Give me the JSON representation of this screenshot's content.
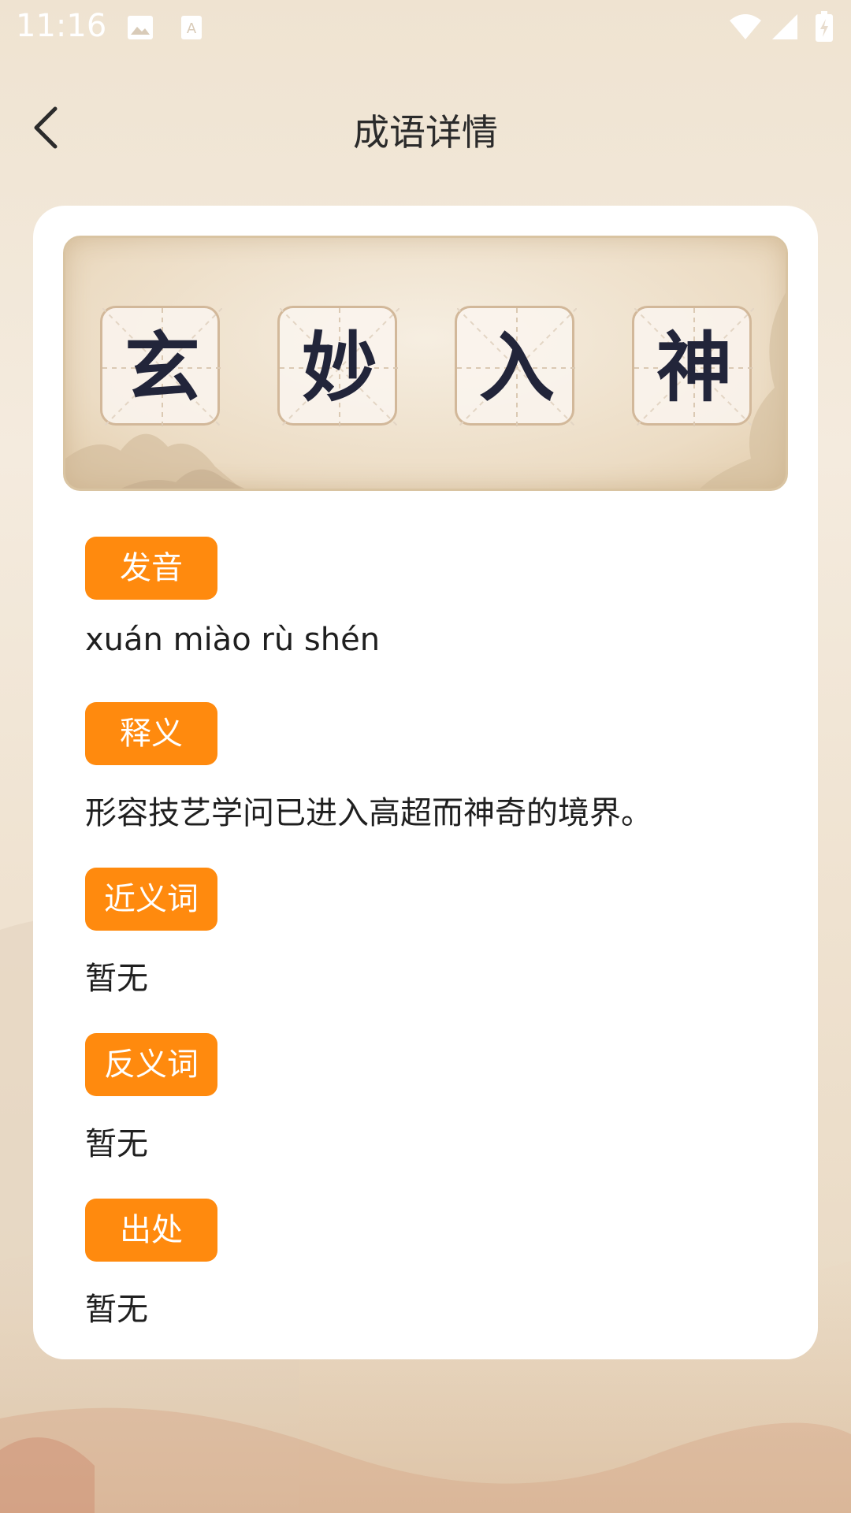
{
  "status_bar": {
    "time": "11:16",
    "icons": [
      "image-icon",
      "text-a-icon",
      "wifi-icon",
      "signal-icon",
      "battery-charging-icon"
    ]
  },
  "header": {
    "back_icon": "chevron-left-icon",
    "title": "成语详情"
  },
  "idiom": {
    "characters": [
      "玄",
      "妙",
      "入",
      "神"
    ]
  },
  "sections": [
    {
      "label": "发音",
      "content": "xuán miào rù shén"
    },
    {
      "label": "释义",
      "content": "形容技艺学问已进入高超而神奇的境界。"
    },
    {
      "label": "近义词",
      "content": "暂无"
    },
    {
      "label": "反义词",
      "content": "暂无"
    },
    {
      "label": "出处",
      "content": "暂无"
    }
  ],
  "colors": {
    "accent": "#ff8a0e",
    "text": "#1f1f1f",
    "char": "#22253a",
    "card": "#ffffff"
  }
}
